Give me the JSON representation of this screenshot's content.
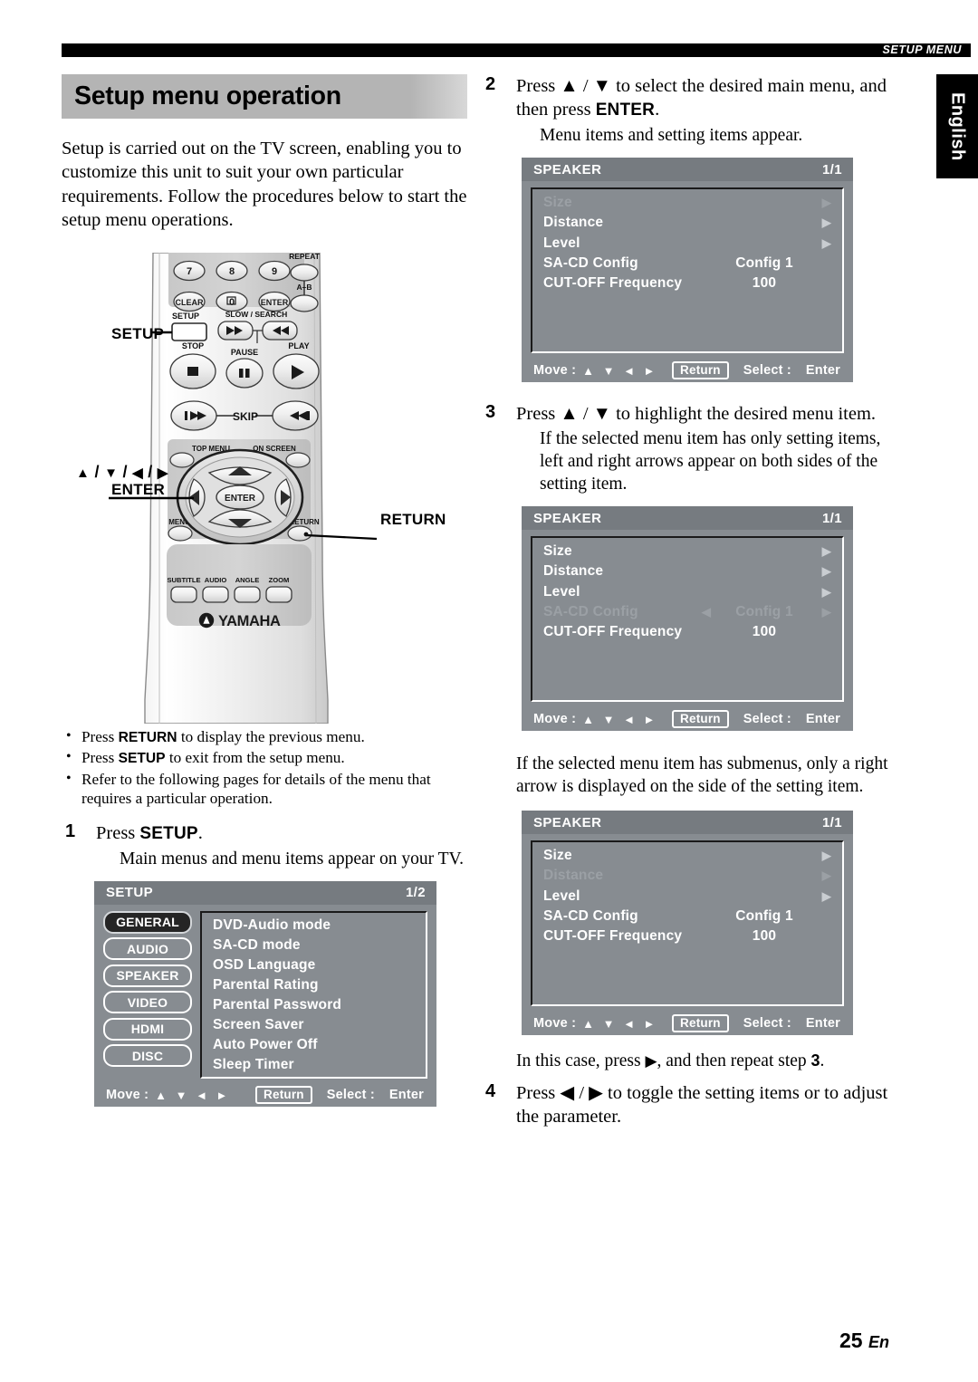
{
  "header": {
    "section_tag": "SETUP MENU",
    "language_tab": "English"
  },
  "page_title": "Setup menu operation",
  "intro_paragraph": "Setup is carried out on the TV screen, enabling you to customize this unit to suit your own particular requirements. Follow the procedures below to start the setup menu operations.",
  "remote": {
    "callouts": {
      "setup": "SETUP",
      "nav_line1": "/ / / ",
      "nav_line2": "ENTER",
      "return": "RETURN"
    },
    "buttons": {
      "num7": "7",
      "num8": "8",
      "num9": "9",
      "clear": "CLEAR",
      "num0": "0",
      "enter_small": "ENTER",
      "repeat": "REPEAT",
      "ab": "A-B",
      "setup": "SETUP",
      "slow_search": "SLOW / SEARCH",
      "stop": "STOP",
      "pause": "PAUSE",
      "play": "PLAY",
      "skip": "SKIP",
      "top_menu": "TOP MENU",
      "on_screen": "ON SCREEN",
      "menu": "MENU",
      "return": "RETURN",
      "enter": "ENTER",
      "subtitle": "SUBTITLE",
      "audio": "AUDIO",
      "angle": "ANGLE",
      "zoom": "ZOOM",
      "brand": "YAMAHA"
    }
  },
  "bullets": [
    {
      "pre": "Press ",
      "bold": "RETURN",
      "post": " to display the previous menu."
    },
    {
      "pre": "Press ",
      "bold": "SETUP",
      "post": " to exit from the setup menu."
    },
    {
      "pre": "Refer to the following pages for details of the menu that requires a particular operation.",
      "bold": "",
      "post": ""
    }
  ],
  "steps": {
    "step1": {
      "num": "1",
      "lead_pre": "Press ",
      "lead_bold": "SETUP",
      "lead_post": ".",
      "sub": "Main menus and menu items appear on your TV."
    },
    "step2": {
      "num": "2",
      "lead_pre": "Press ",
      "lead_mid": " to select the desired main menu, and then press ",
      "lead_bold": "ENTER",
      "lead_post": ".",
      "sub": "Menu items and setting items appear."
    },
    "step3": {
      "num": "3",
      "lead_pre": "Press ",
      "lead_post": " to highlight the desired menu item.",
      "sub": "If the selected menu item has only setting items, left and right arrows appear on both sides of the setting item."
    },
    "note_submenu": "If the selected menu item has submenus, only a right arrow is displayed on the side of the setting item.",
    "note_incase_pre": "In this case, press ",
    "note_incase_mid": ", and then repeat step ",
    "note_incase_num": "3",
    "note_incase_post": ".",
    "step4": {
      "num": "4",
      "lead_pre": "Press ",
      "lead_post": " to toggle the setting items or to adjust the parameter."
    }
  },
  "osd_setup": {
    "title": "SETUP",
    "page": "1/2",
    "tabs": [
      {
        "label": "GENERAL",
        "selected": true
      },
      {
        "label": "AUDIO",
        "selected": false
      },
      {
        "label": "SPEAKER",
        "selected": false
      },
      {
        "label": "VIDEO",
        "selected": false
      },
      {
        "label": "HDMI",
        "selected": false
      },
      {
        "label": "DISC",
        "selected": false
      }
    ],
    "items": [
      "DVD-Audio mode",
      "SA-CD mode",
      "OSD Language",
      "Parental Rating",
      "Parental Password",
      "Screen Saver",
      "Auto Power Off",
      "Sleep Timer"
    ],
    "footer": {
      "move_label": "Move :",
      "arrows": "▲ ▼ ◄ ►",
      "return": "Return",
      "select_label": "Select :",
      "enter": "Enter"
    }
  },
  "osd_speaker_1": {
    "title": "SPEAKER",
    "page": "1/1",
    "rows": [
      {
        "label": "Size",
        "value": "",
        "left_arrow": false,
        "right_arrow": true,
        "dim": true
      },
      {
        "label": "Distance",
        "value": "",
        "left_arrow": false,
        "right_arrow": true,
        "dim": false
      },
      {
        "label": "Level",
        "value": "",
        "left_arrow": false,
        "right_arrow": true,
        "dim": false
      },
      {
        "label": "SA-CD Config",
        "value": "Config 1",
        "left_arrow": false,
        "right_arrow": false,
        "dim": false
      },
      {
        "label": "CUT-OFF Frequency",
        "value": "100",
        "left_arrow": false,
        "right_arrow": false,
        "dim": false
      }
    ],
    "footer": {
      "move_label": "Move :",
      "arrows": "▲ ▼ ◄ ►",
      "return": "Return",
      "select_label": "Select :",
      "enter": "Enter"
    }
  },
  "osd_speaker_2": {
    "title": "SPEAKER",
    "page": "1/1",
    "rows": [
      {
        "label": "Size",
        "value": "",
        "left_arrow": false,
        "right_arrow": true,
        "dim": false
      },
      {
        "label": "Distance",
        "value": "",
        "left_arrow": false,
        "right_arrow": true,
        "dim": false
      },
      {
        "label": "Level",
        "value": "",
        "left_arrow": false,
        "right_arrow": true,
        "dim": false
      },
      {
        "label": "SA-CD Config",
        "value": "Config 1",
        "left_arrow": true,
        "right_arrow": true,
        "dim": true
      },
      {
        "label": "CUT-OFF Frequency",
        "value": "100",
        "left_arrow": false,
        "right_arrow": false,
        "dim": false
      }
    ],
    "footer": {
      "move_label": "Move :",
      "arrows": "▲ ▼ ◄ ►",
      "return": "Return",
      "select_label": "Select :",
      "enter": "Enter"
    }
  },
  "osd_speaker_3": {
    "title": "SPEAKER",
    "page": "1/1",
    "rows": [
      {
        "label": "Size",
        "value": "",
        "left_arrow": false,
        "right_arrow": true,
        "dim": false
      },
      {
        "label": "Distance",
        "value": "",
        "left_arrow": false,
        "right_arrow": true,
        "dim": true
      },
      {
        "label": "Level",
        "value": "",
        "left_arrow": false,
        "right_arrow": true,
        "dim": false
      },
      {
        "label": "SA-CD Config",
        "value": "Config 1",
        "left_arrow": false,
        "right_arrow": false,
        "dim": false
      },
      {
        "label": "CUT-OFF Frequency",
        "value": "100",
        "left_arrow": false,
        "right_arrow": false,
        "dim": false
      }
    ],
    "footer": {
      "move_label": "Move :",
      "arrows": "▲ ▼ ◄ ►",
      "return": "Return",
      "select_label": "Select :",
      "enter": "Enter"
    }
  },
  "footer": {
    "page_number": "25",
    "page_suffix": "En"
  },
  "colors": {
    "osd_body": "#878c91",
    "osd_title_bar": "#767b80",
    "osd_dim_text": "#9ba0a5",
    "title_band": "#b4b4b4",
    "tag_black": "#000000"
  }
}
